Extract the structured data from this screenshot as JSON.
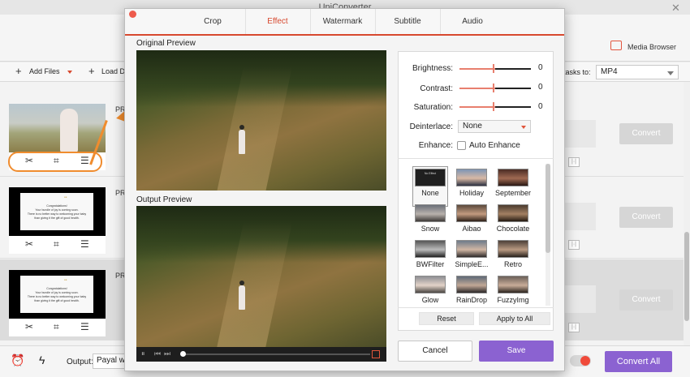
{
  "app": {
    "title": "UniConverter",
    "media_browser": "Media Browser",
    "toolbar": {
      "add_files": "Add Files",
      "load_dvd": "Load DV",
      "tasks_to": "tasks to:",
      "format": "MP4"
    },
    "rows": [
      {
        "label": "PR",
        "convert": "Convert"
      },
      {
        "label": "PR",
        "convert": "Convert"
      },
      {
        "label": "PR",
        "convert": "Convert"
      }
    ],
    "thumb_text": [
      "Congratulations!",
      "Your bundle of joy is coming soon.",
      "There is no better way to welcoming your baby",
      "than giving it the gift of good health."
    ],
    "output_label": "Output:",
    "output_value": "Payal wo",
    "convert_all": "Convert All"
  },
  "dialog": {
    "tabs": [
      "Crop",
      "Effect",
      "Watermark",
      "Subtitle",
      "Audio"
    ],
    "active_tab": "Effect",
    "original_preview": "Original Preview",
    "output_preview": "Output Preview",
    "adjust": {
      "brightness": {
        "label": "Brightness:",
        "value": "0"
      },
      "contrast": {
        "label": "Contrast:",
        "value": "0"
      },
      "saturation": {
        "label": "Saturation:",
        "value": "0"
      },
      "deinterlace": {
        "label": "Deinterlace:",
        "value": "None"
      },
      "enhance": {
        "label": "Enhance:",
        "option": "Auto Enhance"
      }
    },
    "filters": [
      "None",
      "Holiday",
      "September",
      "Snow",
      "Aibao",
      "Chocolate",
      "BWFilter",
      "SimpleE...",
      "Retro",
      "Glow",
      "RainDrop",
      "FuzzyImg"
    ],
    "filter_none_thumb": "No Effect",
    "reset": "Reset",
    "apply_to_all": "Apply to All",
    "cancel": "Cancel",
    "save": "Save"
  },
  "colors": {
    "accent": "#d7492f",
    "purple": "#8b62d1",
    "highlight": "#f08c2e"
  }
}
